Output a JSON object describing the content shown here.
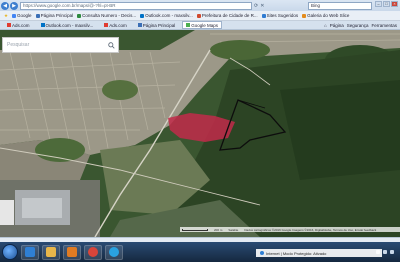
{
  "browser": {
    "url": "https://www.google.com.br/maps/@-?hl=pt-BR",
    "search_placeholder": "Bing",
    "window_controls": [
      "minimize-icon",
      "maximize-icon",
      "close-icon"
    ]
  },
  "favorites": [
    {
      "label": "Google",
      "color": "#4285f4"
    },
    {
      "label": "Página Principal",
      "color": "#3b6fb6"
    },
    {
      "label": "Consulta Numero - Decis...",
      "color": "#2d8a3e"
    },
    {
      "label": "Outlook.com - maxsilv...",
      "color": "#0072c6"
    },
    {
      "label": "Prefeitura de Cidade de R...",
      "color": "#d04a2f"
    },
    {
      "label": "Sites Sugeridos",
      "color": "#2f7bd1"
    },
    {
      "label": "Galeria do Web Slice",
      "color": "#e38b1c"
    }
  ],
  "tabs": [
    {
      "label": "Ads.com",
      "active": false,
      "color": "#e03c31"
    },
    {
      "label": "Outlook.com - maxsilv...",
      "active": false,
      "color": "#0072c6"
    },
    {
      "label": "Ads.com",
      "active": false,
      "color": "#e03c31"
    },
    {
      "label": "Página Principal",
      "active": false,
      "color": "#3b6fb6"
    },
    {
      "label": "Google Maps",
      "active": true,
      "color": "#4caf50"
    }
  ],
  "command_bar": [
    "Página",
    "Segurança",
    "Ferramentas"
  ],
  "map": {
    "search_placeholder": "Pesquisar",
    "footer_scale": "200 m",
    "footer_mode": "Satélite",
    "footer_attribution": "Dados cartográficos ©2016 Google Imagens ©2016, DigitalGlobe, Termos de Uso, Enviar feedback"
  },
  "status": {
    "notification": "Internet | Modo Protegido: Ativado"
  },
  "taskbar": {
    "apps": [
      {
        "name": "internet-explorer-app",
        "color": "#2f7fd4"
      },
      {
        "name": "file-explorer-app",
        "color": "#e8b64a"
      },
      {
        "name": "media-player-app",
        "color": "#e07b22"
      },
      {
        "name": "chrome-app",
        "color": "#d9453a"
      },
      {
        "name": "skype-app",
        "color": "#2aa2e0"
      }
    ]
  }
}
